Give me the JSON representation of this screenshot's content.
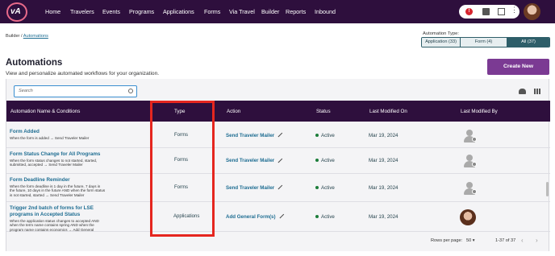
{
  "nav": {
    "logo": "vA",
    "items": [
      "Home",
      "Travelers",
      "Events",
      "Programs",
      "Applications",
      "Forms",
      "Via Travel",
      "Builder",
      "Reports",
      "Inbound"
    ],
    "notification_count": "!"
  },
  "breadcrumb": {
    "parent": "Builder",
    "sep": " / ",
    "current": "Automations"
  },
  "filter": {
    "label": "Automation Type:",
    "options": [
      "Application (33)",
      "Form (4)",
      "All (37)"
    ],
    "selected": "All (37)"
  },
  "page": {
    "title": "Automations",
    "subtitle": "View and personalize automated workflows for your organization.",
    "create_label": "Create New"
  },
  "search": {
    "placeholder": "Search"
  },
  "table": {
    "headers": [
      "Automation Name & Conditions",
      "Type",
      "Action",
      "Status",
      "Last Modified On",
      "Last Modified By"
    ],
    "rows": [
      {
        "title": [
          "Form Added"
        ],
        "cond": [
          "When the form is added → Send Traveler Mailer"
        ],
        "type": "Forms",
        "action": "Send Traveler Mailer",
        "status": "Active",
        "date": "Mar 19, 2024",
        "by": "default"
      },
      {
        "title": [
          "Form Status Change for All Programs"
        ],
        "cond": [
          "When the form status changes to not started, started,",
          "submitted, accepted → Send Traveler Mailer"
        ],
        "type": "Forms",
        "action": "Send Traveler Mailer",
        "status": "Active",
        "date": "Mar 19, 2024",
        "by": "default"
      },
      {
        "title": [
          "Form Deadline Reminder"
        ],
        "cond": [
          "When the form deadline is 1 day in the future, 7 days in",
          "the future, 10 days in the future AND when the form status",
          "is not started, started → Send Traveler Mailer"
        ],
        "type": "Forms",
        "action": "Send Traveler Mailer",
        "status": "Active",
        "date": "Mar 19, 2024",
        "by": "default"
      },
      {
        "title": [
          "Trigger 2nd batch of forms for LSE",
          "programs in Accepted Status"
        ],
        "cond": [
          "When the application status changes to accepted AND",
          "when the term name contains spring AND when the",
          "program name contains economics → Add General"
        ],
        "type": "Applications",
        "action": "Add General Form(s)",
        "status": "Active",
        "date": "Mar 19, 2024",
        "by": "photo"
      }
    ]
  },
  "pagination": {
    "rows_per_page_label": "Rows per page:",
    "rows_per_page": "50",
    "range": "1-37 of 37"
  },
  "colors": {
    "nav_bg": "#2e0f3d",
    "accent_link": "#1e6d92",
    "create_button": "#7b3a93",
    "highlight_box": "#e5261f",
    "active_dot": "#1c7d3a"
  }
}
